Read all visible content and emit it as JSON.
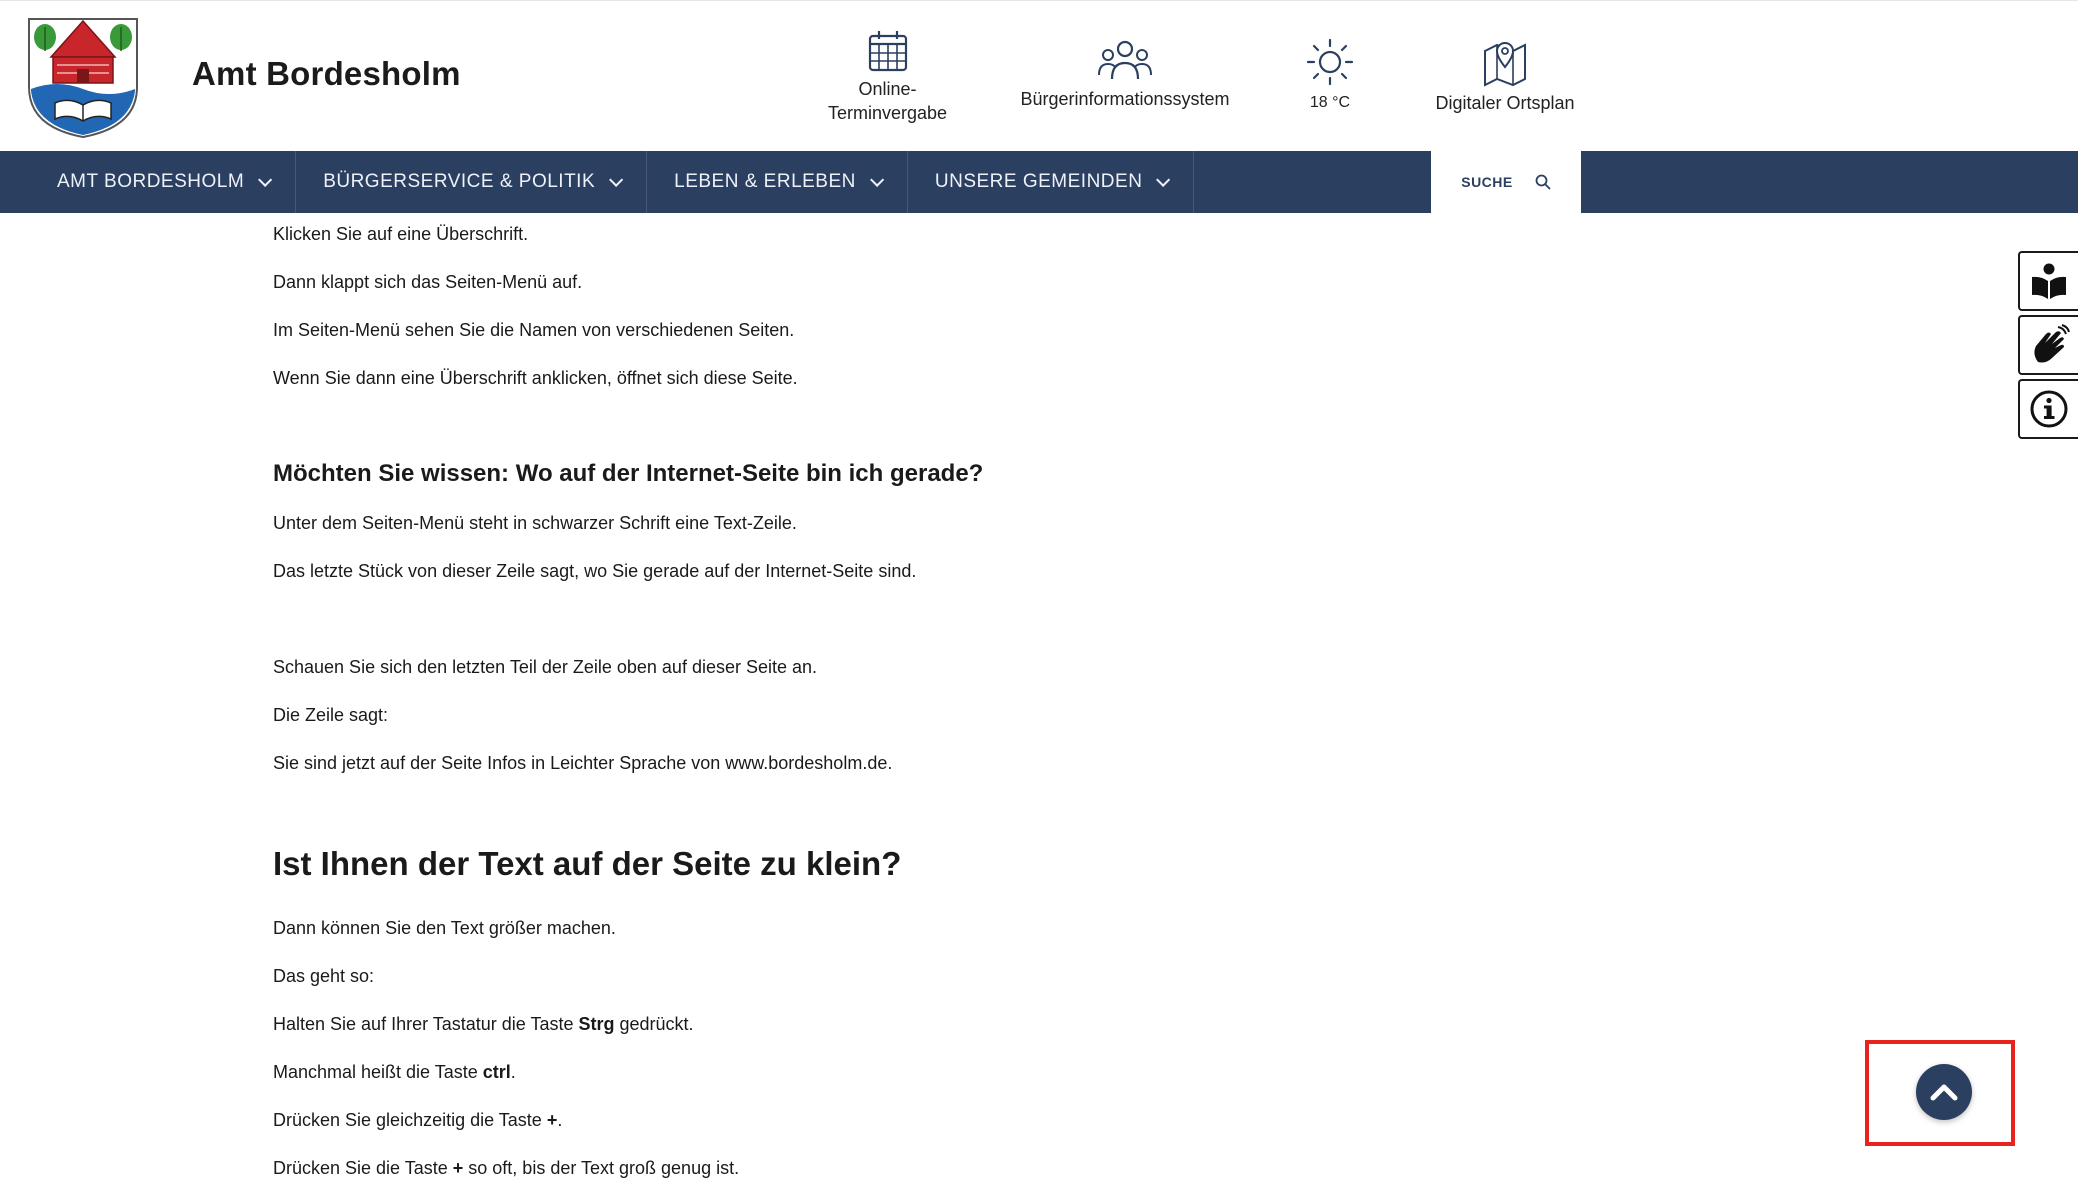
{
  "header": {
    "site_title": "Amt Bordesholm",
    "logo_icon": "coat-of-arms-icon",
    "quick_links": [
      {
        "icon": "calendar-icon",
        "label_line1": "Online-",
        "label_line2": "Terminvergabe"
      },
      {
        "icon": "people-icon",
        "label": "Bürgerinformationssystem"
      },
      {
        "icon": "sun-icon",
        "label": "18 °C"
      },
      {
        "icon": "map-pin-icon",
        "label": "Digitaler Ortsplan"
      }
    ]
  },
  "nav": {
    "items": [
      {
        "label": "AMT BORDESHOLM"
      },
      {
        "label": "BÜRGERSERVICE & POLITIK"
      },
      {
        "label": "LEBEN & ERLEBEN"
      },
      {
        "label": "UNSERE GEMEINDEN"
      }
    ],
    "search_label": "SUCHE"
  },
  "content": {
    "p1": "Klicken Sie auf eine Überschrift.",
    "p2": "Dann klappt sich das Seiten-Menü auf.",
    "p3": "Im Seiten-Menü sehen Sie die Namen von verschiedenen Seiten.",
    "p4": "Wenn Sie dann eine Überschrift anklicken, öffnet sich diese Seite.",
    "h_where": "Möchten Sie wissen: Wo auf der Internet-Seite bin ich gerade?",
    "p5": "Unter dem Seiten-Menü steht in schwarzer Schrift eine Text-Zeile.",
    "p6": "Das letzte Stück von dieser Zeile sagt, wo Sie gerade auf der Internet-Seite sind.",
    "p7": "Schauen Sie sich den letzten Teil der Zeile oben auf dieser Seite an.",
    "p8": "Die Zeile sagt:",
    "p9": "Sie sind jetzt auf der Seite Infos in Leichter Sprache von www.bordesholm.de.",
    "h_small": "Ist Ihnen der Text auf der Seite zu klein?",
    "p10": "Dann können Sie den Text größer machen.",
    "p11": "Das geht so:",
    "p12_a": "Halten Sie auf Ihrer Tastatur die Taste ",
    "p12_b": "Strg",
    "p12_c": " gedrückt.",
    "p13_a": "Manchmal heißt die Taste ",
    "p13_b": "ctrl",
    "p13_c": ".",
    "p14_a": "Drücken Sie gleichzeitig die Taste ",
    "p14_b": "+",
    "p14_c": ".",
    "p15_a": "Drücken Sie die Taste ",
    "p15_b": "+",
    "p15_c": " so oft, bis der Text groß genug ist."
  },
  "side_tools": [
    {
      "icon": "easy-language-icon"
    },
    {
      "icon": "sign-language-icon"
    },
    {
      "icon": "info-icon"
    }
  ],
  "back_to_top": {
    "icon": "chevron-up-icon"
  },
  "colors": {
    "nav_bg": "#2b3f60",
    "highlight": "#e8231b"
  }
}
